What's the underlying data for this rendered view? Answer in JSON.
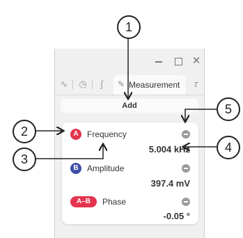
{
  "window": {
    "controls": {
      "minimize": "minimize-icon",
      "maximize": "maximize-icon",
      "close": "close-icon"
    },
    "tabs": [
      {
        "icon": "waveform-icon"
      },
      {
        "icon": "timer-icon"
      },
      {
        "icon": "integral-icon"
      },
      {
        "icon": "pencil-icon",
        "label": "Measurement",
        "active": true
      },
      {
        "icon": "math-icon"
      }
    ],
    "add_label": "Add"
  },
  "measurements": [
    {
      "badge": "A",
      "badge_color": "#e5344e",
      "label": "Frequency",
      "value": "5.004 kHz"
    },
    {
      "badge": "B",
      "badge_color": "#3f4ea8",
      "label": "Amplitude",
      "value": "397.4 mV"
    },
    {
      "badge": "A–B",
      "badge_color": "#e5344e",
      "label": "Phase",
      "value": "-0.05 °"
    }
  ],
  "callouts": [
    "1",
    "2",
    "3",
    "4",
    "5"
  ]
}
